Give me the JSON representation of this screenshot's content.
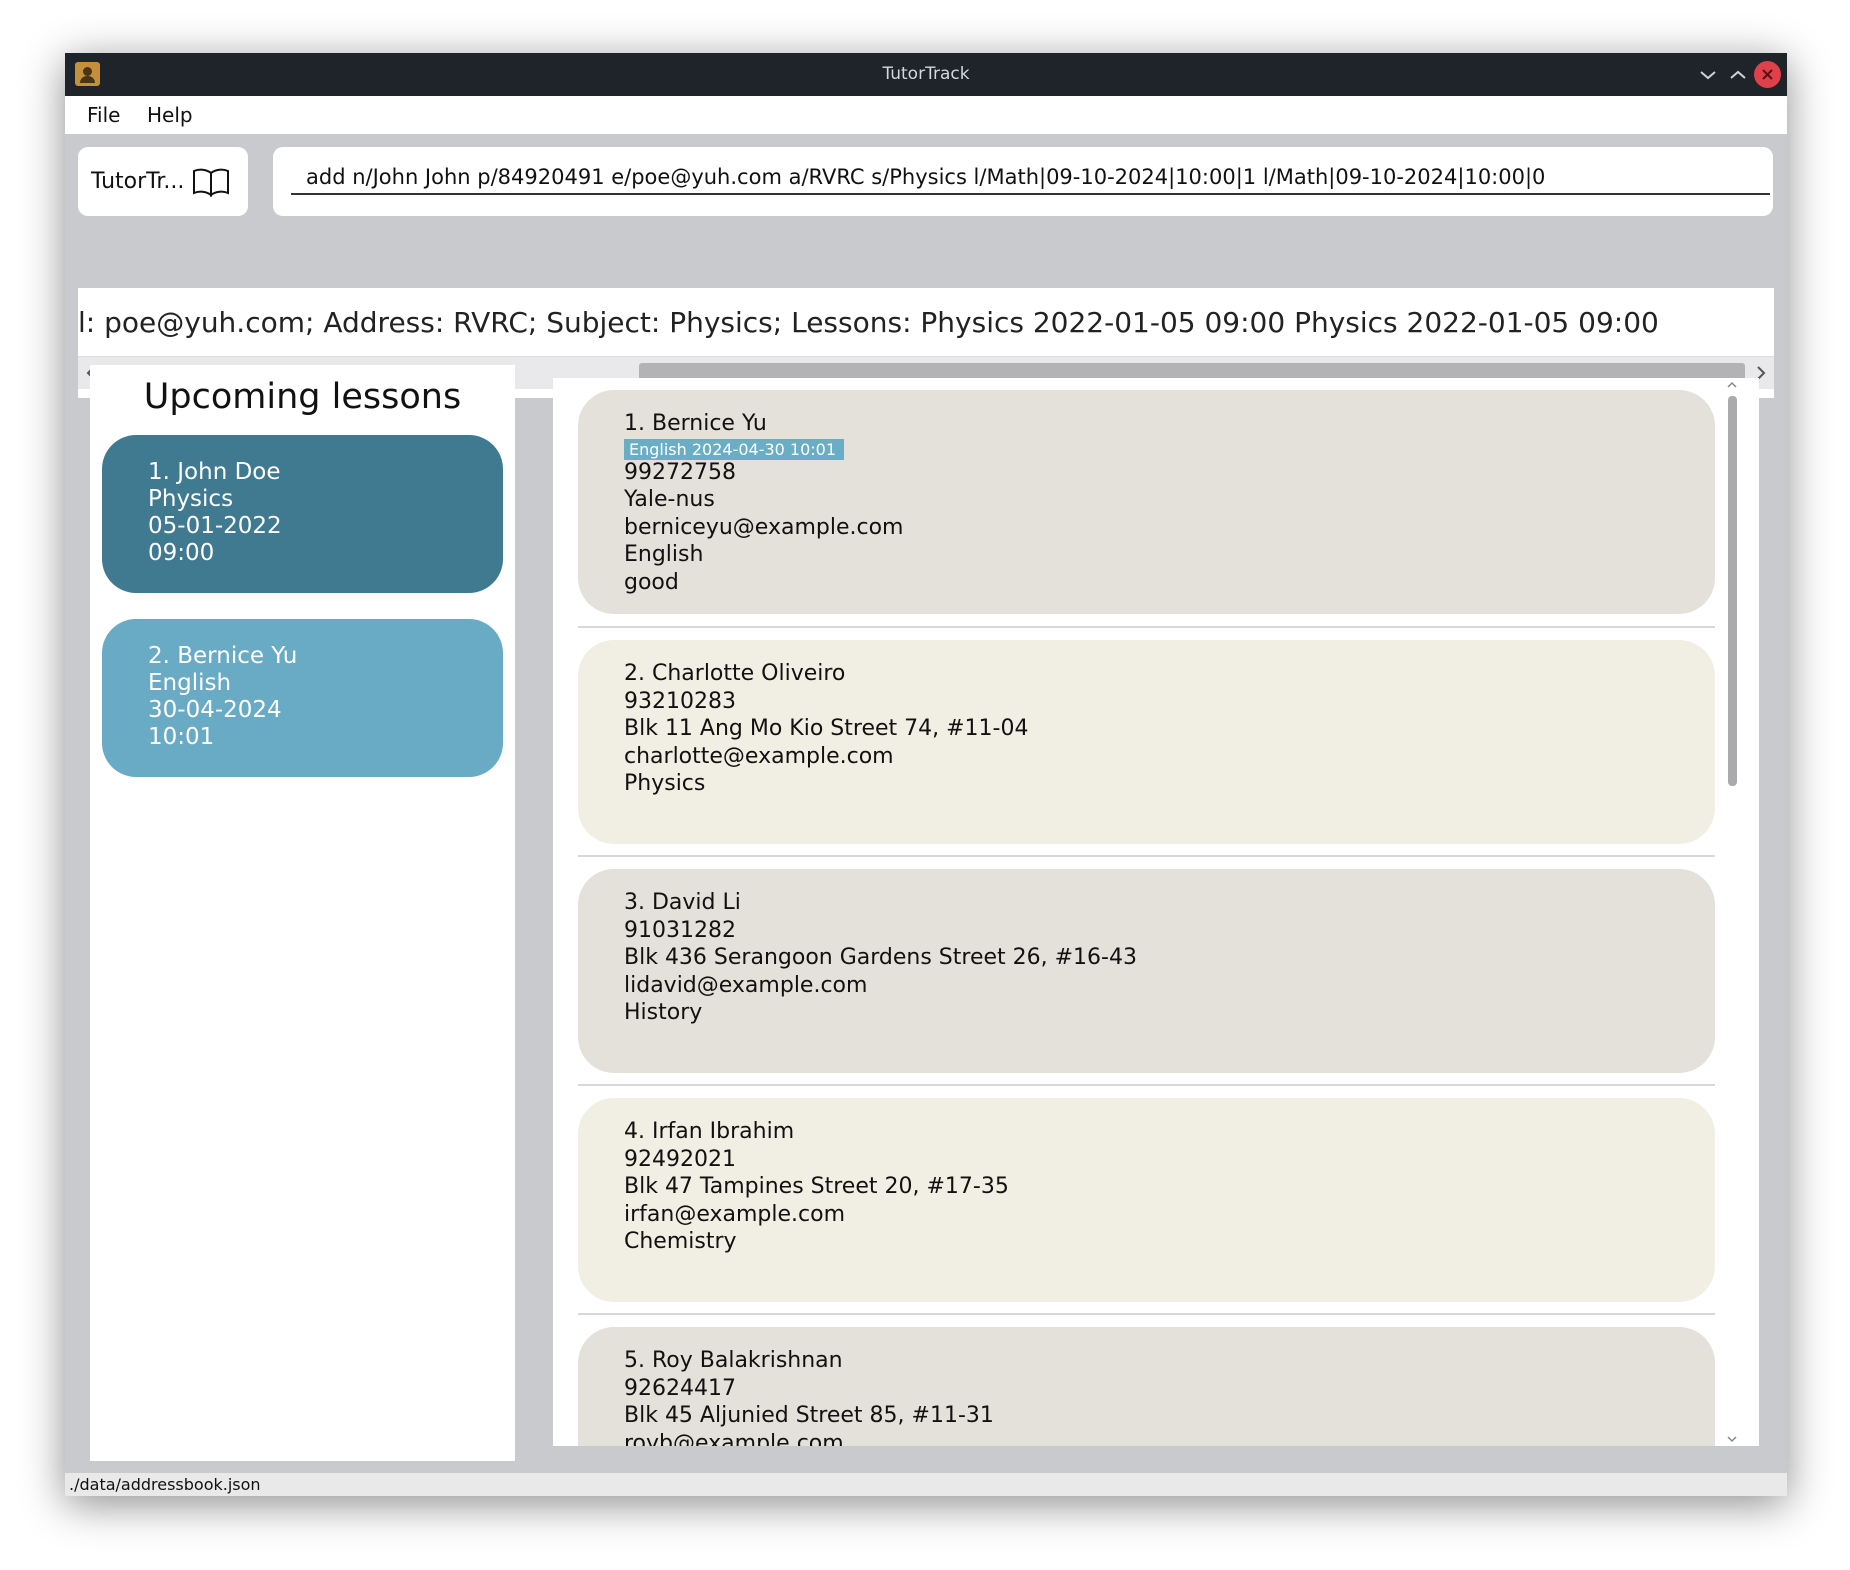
{
  "window": {
    "title": "TutorTrack"
  },
  "menu": {
    "file": "File",
    "help": "Help"
  },
  "brand": {
    "label": "TutorTr..."
  },
  "command": {
    "value": "add n/John John p/84920491 e/poe@yuh.com a/RVRC s/Physics l/Math|09-10-2024|10:00|1 l/Math|09-10-2024|10:00|0"
  },
  "result": {
    "text": "l: poe@yuh.com; Address: RVRC; Subject: Physics; Lessons: Physics  2022-01-05  09:00 Physics  2022-01-05  09:00"
  },
  "upcoming": {
    "title": "Upcoming lessons",
    "items": [
      {
        "index_name": "1.  John Doe",
        "subject": "Physics",
        "date": "05-01-2022",
        "time": "09:00"
      },
      {
        "index_name": "2.  Bernice Yu",
        "subject": "English",
        "date": "30-04-2024",
        "time": "10:01"
      }
    ]
  },
  "persons": [
    {
      "index_name": "1.  Bernice Yu",
      "tag": "English  2024-04-30  10:01",
      "phone": "99272758",
      "address": "Yale-nus",
      "email": "berniceyu@example.com",
      "subject": "English",
      "note": "good"
    },
    {
      "index_name": "2.  Charlotte Oliveiro",
      "phone": "93210283",
      "address": "Blk 11 Ang Mo Kio Street 74, #11-04",
      "email": "charlotte@example.com",
      "subject": "Physics"
    },
    {
      "index_name": "3.  David Li",
      "phone": "91031282",
      "address": "Blk 436 Serangoon Gardens Street 26, #16-43",
      "email": "lidavid@example.com",
      "subject": "History"
    },
    {
      "index_name": "4.  Irfan Ibrahim",
      "phone": "92492021",
      "address": "Blk 47 Tampines Street 20, #17-35",
      "email": "irfan@example.com",
      "subject": "Chemistry"
    },
    {
      "index_name": "5.  Roy Balakrishnan",
      "phone": "92624417",
      "address": "Blk 45 Aljunied Street 85, #11-31",
      "email": "royb@example.com"
    }
  ],
  "status": {
    "path": "./data/addressbook.json"
  },
  "colors": {
    "titlebar": "#1e2429",
    "upcoming_primary": "#3f7a90",
    "upcoming_secondary": "#69aac4",
    "card_odd": "#e4e1da",
    "card_even": "#f1eee3",
    "tag": "#6aaec6",
    "close": "#e0404a"
  }
}
